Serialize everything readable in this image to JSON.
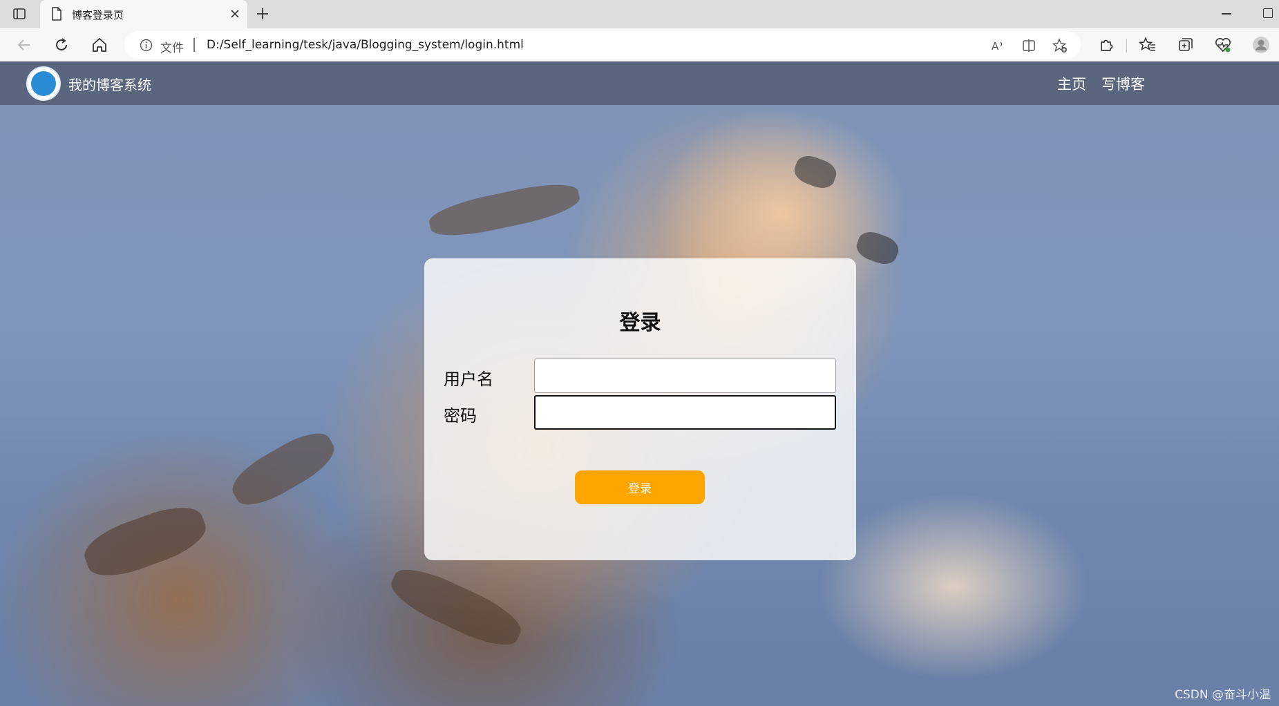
{
  "browser": {
    "tab_title": "博客登录页",
    "address_file_label": "文件",
    "url": "D:/Self_learning/tesk/java/Blogging_system/login.html"
  },
  "navbar": {
    "title": "我的博客系统",
    "links": [
      "主页",
      "写博客"
    ]
  },
  "login": {
    "heading": "登录",
    "username_label": "用户名",
    "username_value": "",
    "password_label": "密码",
    "password_value": "",
    "submit_label": "登录"
  },
  "watermark": "CSDN @奋斗小温",
  "colors": {
    "submit_button": "#ffa500",
    "navbar": "#525c72"
  }
}
